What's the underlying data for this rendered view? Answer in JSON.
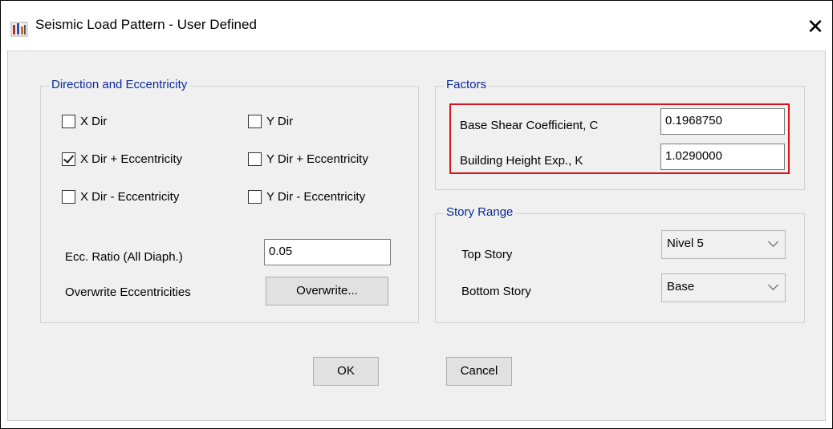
{
  "window": {
    "title": "Seismic Load Pattern - User Defined",
    "close_glyph": "✕"
  },
  "direction_group": {
    "title": "Direction and Eccentricity",
    "checkboxes": [
      {
        "label": "X Dir",
        "checked": false
      },
      {
        "label": "Y Dir",
        "checked": false
      },
      {
        "label": "X Dir + Eccentricity",
        "checked": true
      },
      {
        "label": "Y Dir + Eccentricity",
        "checked": false
      },
      {
        "label": "X Dir - Eccentricity",
        "checked": false
      },
      {
        "label": "Y Dir - Eccentricity",
        "checked": false
      }
    ],
    "ecc_ratio_label": "Ecc. Ratio (All Diaph.)",
    "ecc_ratio_value": "0.05",
    "overwrite_label": "Overwrite Eccentricities",
    "overwrite_button": "Overwrite..."
  },
  "factors_group": {
    "title": "Factors",
    "base_shear_label": "Base Shear Coefficient, C",
    "base_shear_value": "0.1968750",
    "height_exp_label": "Building Height Exp., K",
    "height_exp_value": "1.0290000"
  },
  "story_range_group": {
    "title": "Story Range",
    "top_story_label": "Top Story",
    "top_story_value": "Nivel 5",
    "bottom_story_label": "Bottom Story",
    "bottom_story_value": "Base"
  },
  "buttons": {
    "ok": "OK",
    "cancel": "Cancel"
  },
  "colors": {
    "group_title": "#0a2a9a",
    "highlight": "#d8141e",
    "dialog_bg": "#f0f0f0"
  }
}
